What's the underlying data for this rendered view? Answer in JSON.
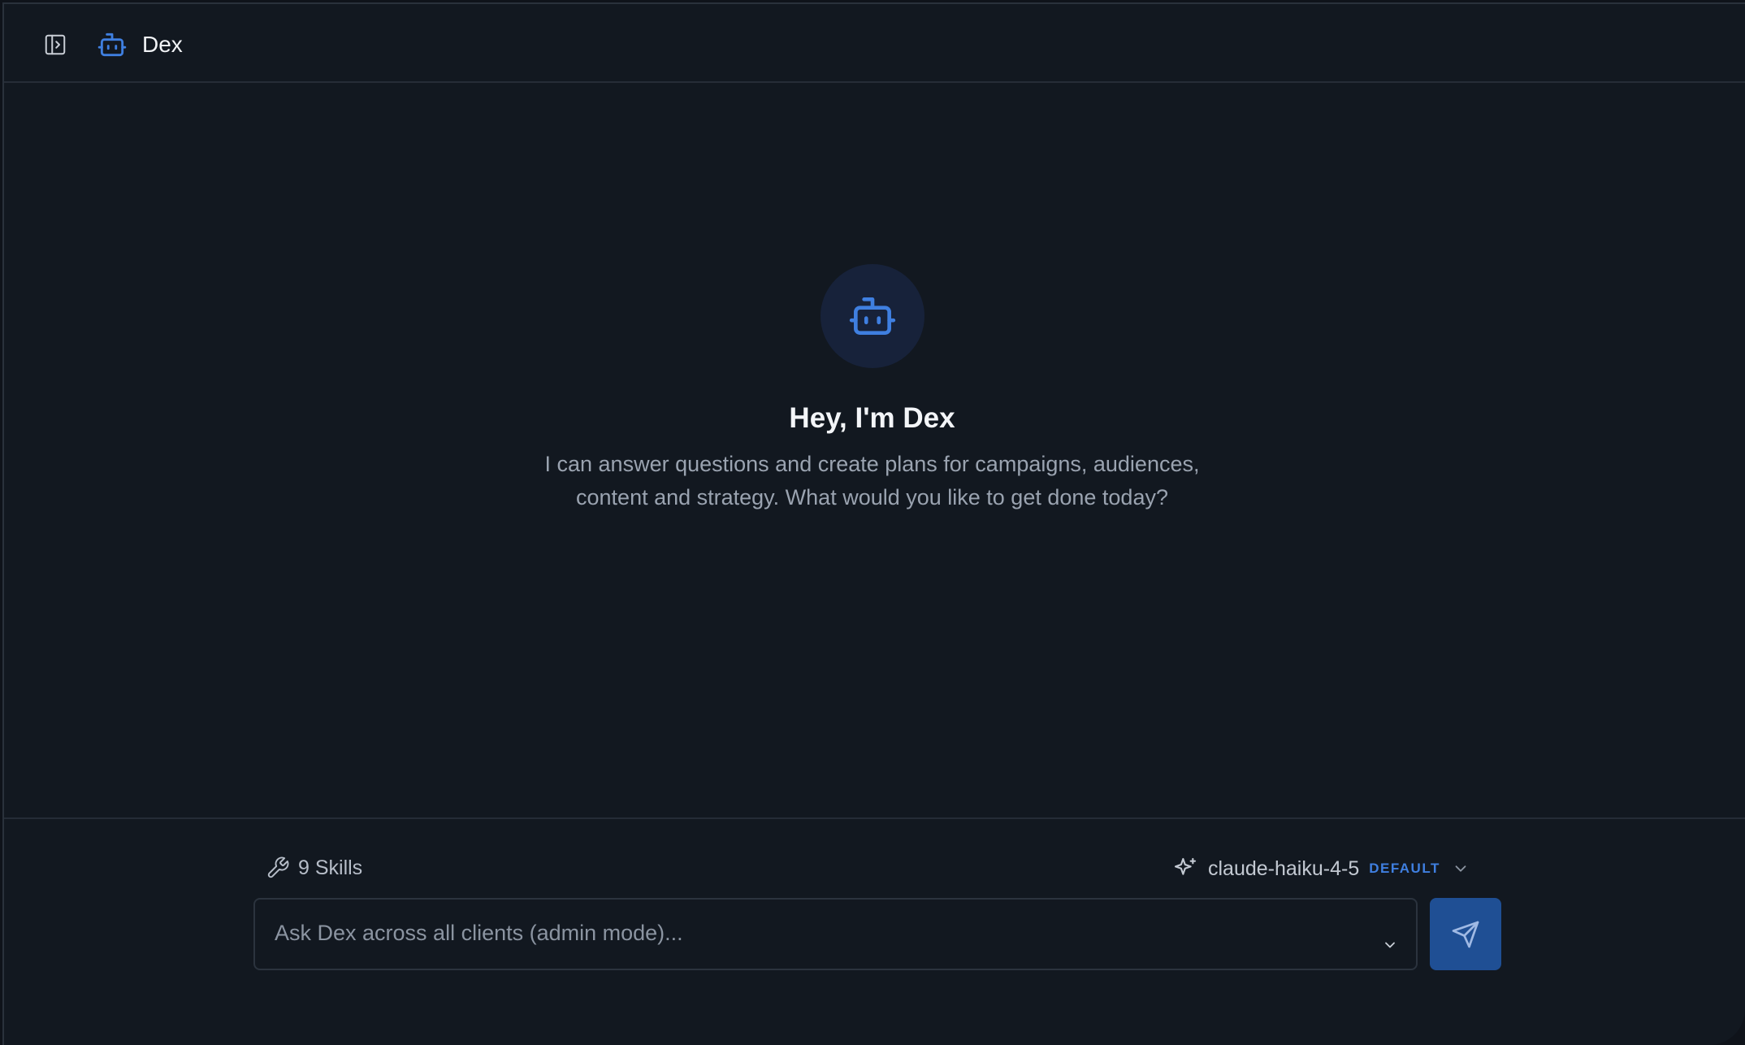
{
  "header": {
    "title": "Dex",
    "sidebar_toggle_icon": "sidebar-toggle-icon",
    "bot_icon": "robot-icon"
  },
  "hero": {
    "icon": "robot-icon",
    "title": "Hey, I'm Dex",
    "subtitle": "I can answer questions and create plans for campaigns, audiences, content and strategy. What would you like to get done today?"
  },
  "composer": {
    "skills_label": "9 Skills",
    "skills_icon": "wrench-icon",
    "model_icon": "sparkles-icon",
    "model_name": "claude-haiku-4-5",
    "model_badge": "DEFAULT",
    "input_placeholder": "Ask Dex across all clients (admin mode)...",
    "input_value": "",
    "send_icon": "send-icon"
  },
  "colors": {
    "background": "#121820",
    "accent": "#3f7fe0",
    "send_button": "#1f4f94",
    "hero_avatar_bg": "#17223a"
  }
}
